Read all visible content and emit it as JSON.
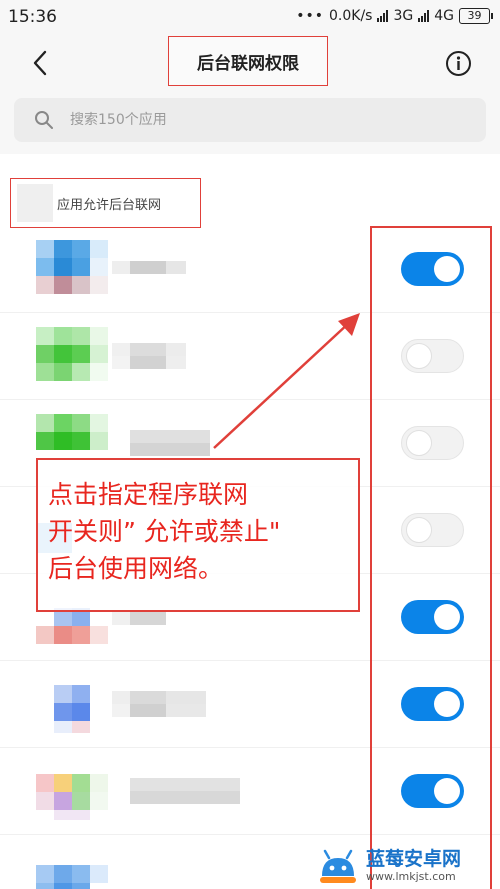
{
  "status_bar": {
    "time": "15:36",
    "net_speed": "0.0K/s",
    "net1": "3G",
    "net2": "4G",
    "battery": "39"
  },
  "header": {
    "title": "后台联网权限"
  },
  "search": {
    "placeholder": "搜索150个应用"
  },
  "section": {
    "label": "应用允许后台联网"
  },
  "apps": [
    {
      "toggle": "on"
    },
    {
      "toggle": "off"
    },
    {
      "toggle": "off"
    },
    {
      "toggle": "off"
    },
    {
      "toggle": "on"
    },
    {
      "toggle": "on"
    },
    {
      "toggle": "on"
    },
    {
      "toggle": ""
    }
  ],
  "annotation": {
    "text": "点击指定程序联网\n开关则” 允许或禁止\"\n后台使用网络。"
  },
  "watermark": {
    "name": "蓝莓安卓网",
    "url": "www.lmkjst.com"
  },
  "colors": {
    "accent": "#0b84e8",
    "annotation": "#e0403a"
  }
}
